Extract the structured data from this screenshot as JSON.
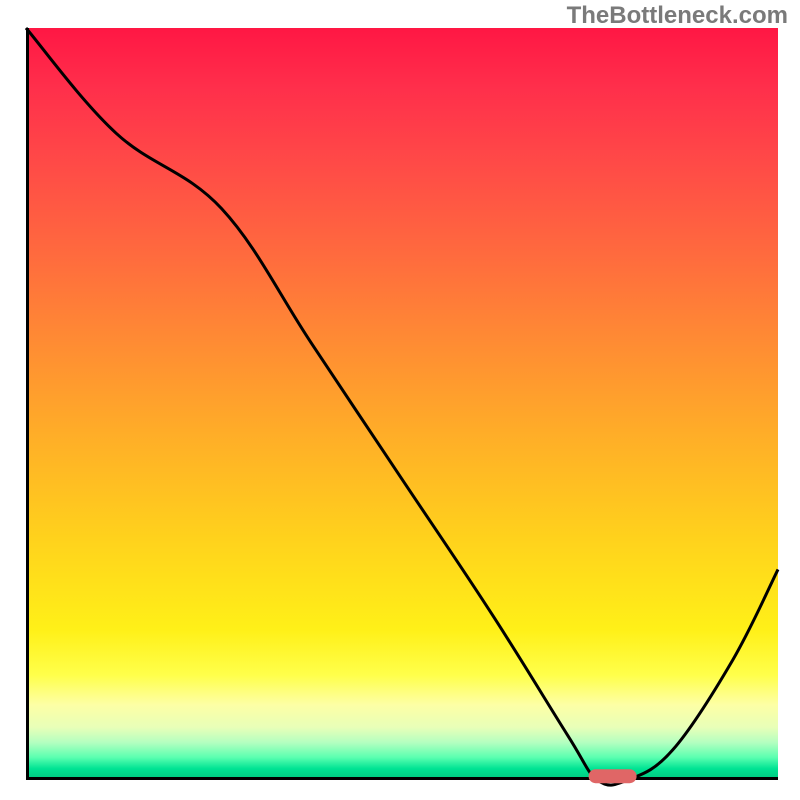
{
  "watermark": "TheBottleneck.com",
  "chart_data": {
    "type": "line",
    "title": "",
    "xlabel": "",
    "ylabel": "",
    "xlim": [
      0,
      100
    ],
    "ylim": [
      0,
      100
    ],
    "series": [
      {
        "name": "bottleneck-curve",
        "x": [
          0,
          12,
          26,
          38,
          50,
          62,
          72,
          76,
          80,
          86,
          94,
          100
        ],
        "values": [
          100,
          86,
          76,
          58,
          40,
          22,
          6,
          0,
          0,
          4,
          16,
          28
        ]
      }
    ],
    "annotations": [
      {
        "name": "optimal-marker",
        "x": 78,
        "y": 0.5,
        "color": "#e06666",
        "shape": "pill"
      }
    ],
    "grid": false,
    "legend": false
  },
  "colors": {
    "curve": "#000000",
    "marker": "#e06666"
  }
}
